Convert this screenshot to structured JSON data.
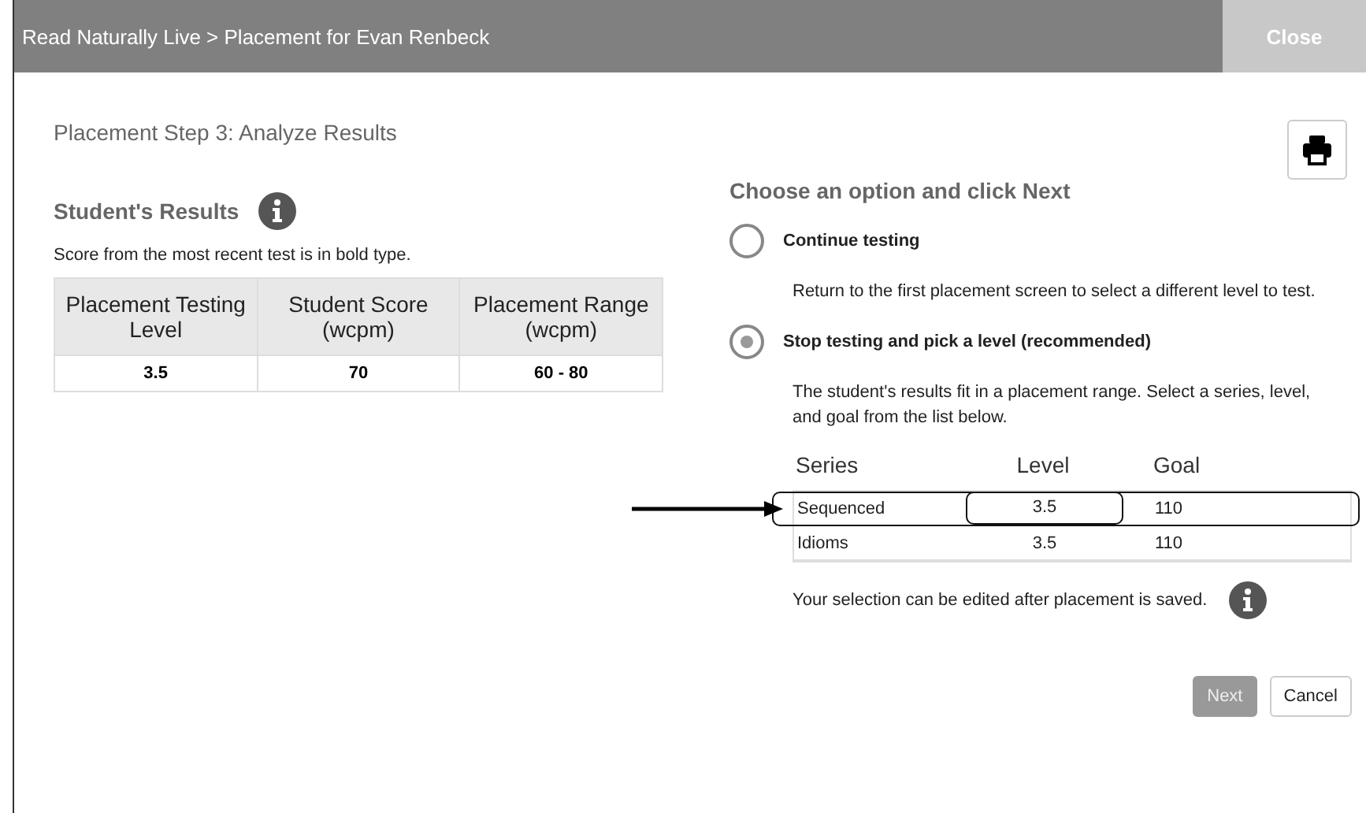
{
  "window": {
    "title": "Read Naturally Live > Placement for Evan Renbeck",
    "close_label": "Close"
  },
  "step_title": "Placement Step 3: Analyze Results",
  "results": {
    "heading": "Student's Results",
    "note": "Score from the most recent test is in bold type.",
    "columns": [
      "Placement Testing Level",
      "Student Score (wcpm)",
      "Placement Range (wcpm)"
    ],
    "rows": [
      [
        "3.5",
        "70",
        "60 - 80"
      ]
    ]
  },
  "options": {
    "heading": "Choose an option and click Next",
    "items": [
      {
        "label": "Continue testing",
        "description": "Return to the first placement screen to select a different level to test.",
        "selected": false
      },
      {
        "label": "Stop testing and pick a level (recommended)",
        "description": "The student's results fit in a placement range. Select a series, level, and goal from the list below.",
        "selected": true
      }
    ]
  },
  "series_table": {
    "columns": [
      "Series",
      "Level",
      "Goal"
    ],
    "rows": [
      {
        "cells": [
          "Sequenced",
          "3.5",
          "110"
        ],
        "highlighted": true
      },
      {
        "cells": [
          "Idioms",
          "3.5",
          "110"
        ],
        "highlighted": false
      }
    ]
  },
  "edit_note": "Your selection can be edited after placement is saved.",
  "annotation_arrow": true,
  "buttons": [
    {
      "label": "Next",
      "disabled": true
    },
    {
      "label": "Cancel",
      "disabled": false
    }
  ]
}
